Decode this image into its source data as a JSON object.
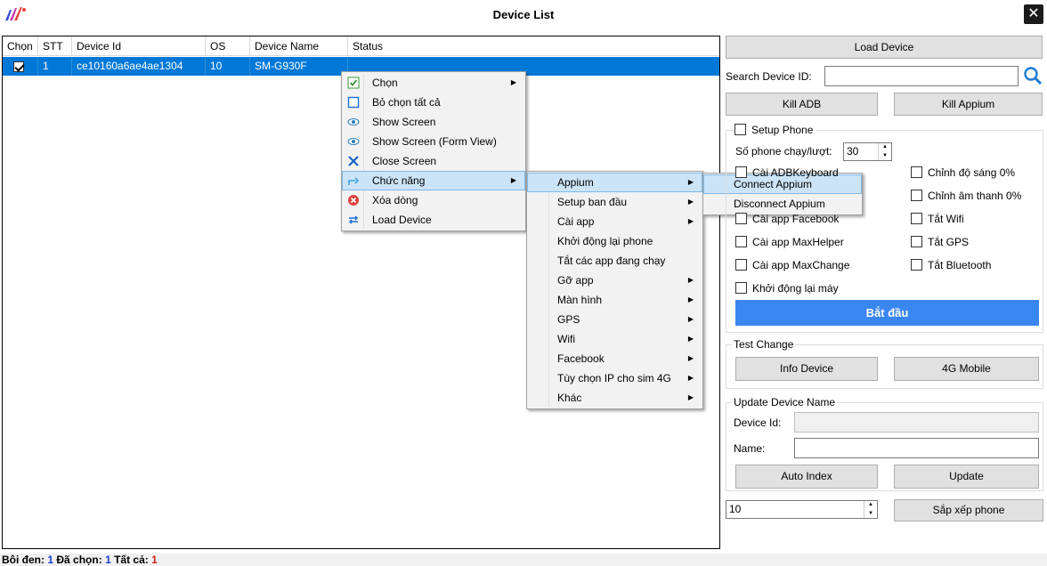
{
  "window": {
    "title": "Device List",
    "close_symbol": "✕",
    "logo_icon": "app-logo"
  },
  "grid": {
    "columns": [
      "Chọn",
      "STT",
      "Device Id",
      "OS",
      "Device Name",
      "Status"
    ],
    "rows": [
      {
        "checked": true,
        "stt": "1",
        "device_id": "ce10160a6ae4ae1304",
        "os": "10",
        "device_name": "SM-G930F",
        "status": ""
      }
    ]
  },
  "context_menu": {
    "items": [
      {
        "label": "Chọn",
        "icon": "check-square-icon",
        "submenu": true
      },
      {
        "label": "Bỏ chọn tất cả",
        "icon": "square-icon",
        "submenu": false
      },
      {
        "label": "Show Screen",
        "icon": "eye-icon",
        "submenu": false
      },
      {
        "label": "Show Screen (Form View)",
        "icon": "eye-icon",
        "submenu": false
      },
      {
        "label": "Close Screen",
        "icon": "x-icon",
        "submenu": false
      },
      {
        "label": "Chức năng",
        "icon": "function-icon",
        "submenu": true,
        "highlighted": true
      },
      {
        "label": "Xóa dòng",
        "icon": "delete-icon",
        "submenu": false
      },
      {
        "label": "Load Device",
        "icon": "reload-icon",
        "submenu": false
      }
    ]
  },
  "submenu_functions": {
    "items": [
      {
        "label": "Appium",
        "submenu": true,
        "highlighted": true
      },
      {
        "label": "Setup ban đầu",
        "submenu": true
      },
      {
        "label": "Cài app",
        "submenu": true
      },
      {
        "label": "Khởi động lại phone",
        "submenu": false
      },
      {
        "label": "Tắt các app đang chạy",
        "submenu": false
      },
      {
        "label": "Gỡ app",
        "submenu": true
      },
      {
        "label": "Màn hình",
        "submenu": true
      },
      {
        "label": "GPS",
        "submenu": true
      },
      {
        "label": "Wifi",
        "submenu": true
      },
      {
        "label": "Facebook",
        "submenu": true
      },
      {
        "label": "Tùy chọn IP cho sim 4G",
        "submenu": true
      },
      {
        "label": "Khác",
        "submenu": true
      }
    ]
  },
  "submenu_appium": {
    "items": [
      {
        "label": "Connect Appium",
        "highlighted": true
      },
      {
        "label": "Disconnect Appium",
        "highlighted": false
      }
    ]
  },
  "right_panel": {
    "load_device": "Load Device",
    "search_label": "Search Device ID:",
    "search_value": "",
    "kill_adb": "Kill ADB",
    "kill_appium": "Kill Appium",
    "setup_phone": "Setup Phone",
    "phone_per_turn_label": "Số phone chạy/lượt:",
    "phone_per_turn_value": "30",
    "left_checks": [
      "Cài ADBKeyboard",
      "Cài app Facebook",
      "Cài app MaxHelper",
      "Cài app MaxChange",
      "Khởi động lại máy"
    ],
    "right_checks": [
      "Chỉnh độ sáng 0%",
      "Chỉnh âm thanh 0%",
      "Tắt Wifi",
      "Tắt GPS",
      "Tắt Bluetooth"
    ],
    "start": "Bắt đầu",
    "test_change": "Test Change",
    "info_device": "Info Device",
    "mobile_4g": "4G Mobile",
    "update_device_name": "Update Device Name",
    "device_id_label": "Device Id:",
    "device_id_value": "",
    "name_label": "Name:",
    "name_value": "",
    "auto_index": "Auto Index",
    "update": "Update",
    "sort_value": "10",
    "sort_phone": "Sắp xếp phone"
  },
  "status": {
    "highlight_label": "Bôi đen:",
    "highlight_value": "1",
    "selected_label": "Đã chọn:",
    "selected_value": "1",
    "total_label": "Tất cả:",
    "total_value": "1"
  }
}
